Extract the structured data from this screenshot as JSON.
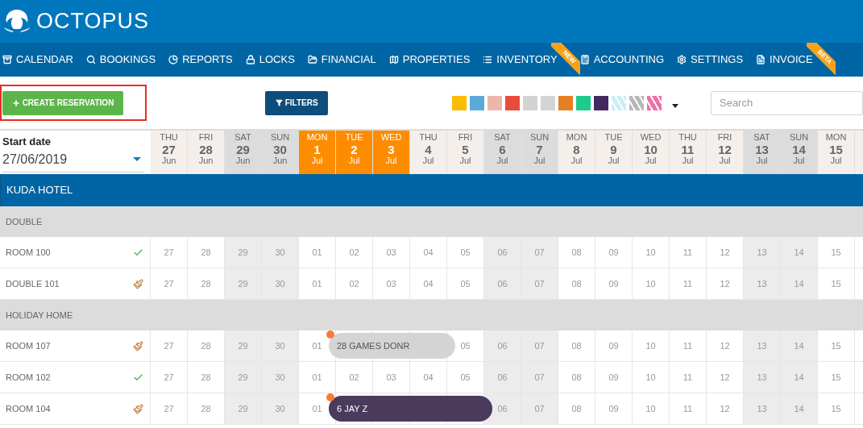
{
  "logo": {
    "text": "OCTOPUS"
  },
  "nav": [
    {
      "label": "CALENDAR"
    },
    {
      "label": "BOOKINGS"
    },
    {
      "label": "REPORTS"
    },
    {
      "label": "LOCKS"
    },
    {
      "label": "FINANCIAL"
    },
    {
      "label": "PROPERTIES"
    },
    {
      "label": "INVENTORY",
      "ribbon": "NEW"
    },
    {
      "label": "ACCOUNTING"
    },
    {
      "label": "SETTINGS"
    },
    {
      "label": "INVOICE",
      "ribbon": "BETA"
    }
  ],
  "toolbar": {
    "create_button": "CREATE RESERVATION",
    "filters_button": "FILTERS",
    "search": {
      "placeholder": "Search"
    },
    "swatches": [
      {
        "kind": "solid",
        "color": "#f9bd00"
      },
      {
        "kind": "solid",
        "color": "#5aaad9"
      },
      {
        "kind": "solid",
        "color": "#f0b5aa"
      },
      {
        "kind": "solid",
        "color": "#e74c3c"
      },
      {
        "kind": "solid",
        "color": "#d3d3d3"
      },
      {
        "kind": "solid",
        "color": "#d4d4d4"
      },
      {
        "kind": "solid",
        "color": "#e67e22"
      },
      {
        "kind": "solid",
        "color": "#1ecb8a"
      },
      {
        "kind": "solid",
        "color": "#432a5e"
      },
      {
        "kind": "striped",
        "color": "#c9eef7"
      },
      {
        "kind": "striped",
        "color": "#b8b8b8"
      },
      {
        "kind": "striped",
        "color": "#f06fa8"
      }
    ]
  },
  "start_date": {
    "label": "Start date",
    "value": "27/06/2019"
  },
  "days": [
    {
      "weekday": "THU",
      "day": "27",
      "month": "Jun",
      "weekend": false,
      "selected": false
    },
    {
      "weekday": "FRI",
      "day": "28",
      "month": "Jun",
      "weekend": false,
      "selected": false
    },
    {
      "weekday": "SAT",
      "day": "29",
      "month": "Jun",
      "weekend": true,
      "selected": false
    },
    {
      "weekday": "SUN",
      "day": "30",
      "month": "Jun",
      "weekend": true,
      "selected": false
    },
    {
      "weekday": "MON",
      "day": "1",
      "month": "Jul",
      "weekend": false,
      "selected": true
    },
    {
      "weekday": "TUE",
      "day": "2",
      "month": "Jul",
      "weekend": false,
      "selected": true
    },
    {
      "weekday": "WED",
      "day": "3",
      "month": "Jul",
      "weekend": false,
      "selected": true
    },
    {
      "weekday": "THU",
      "day": "4",
      "month": "Jul",
      "weekend": false,
      "selected": false
    },
    {
      "weekday": "FRI",
      "day": "5",
      "month": "Jul",
      "weekend": false,
      "selected": false
    },
    {
      "weekday": "SAT",
      "day": "6",
      "month": "Jul",
      "weekend": true,
      "selected": false
    },
    {
      "weekday": "SUN",
      "day": "7",
      "month": "Jul",
      "weekend": true,
      "selected": false
    },
    {
      "weekday": "MON",
      "day": "8",
      "month": "Jul",
      "weekend": false,
      "selected": false
    },
    {
      "weekday": "TUE",
      "day": "9",
      "month": "Jul",
      "weekend": false,
      "selected": false
    },
    {
      "weekday": "WED",
      "day": "10",
      "month": "Jul",
      "weekend": false,
      "selected": false
    },
    {
      "weekday": "THU",
      "day": "11",
      "month": "Jul",
      "weekend": false,
      "selected": false
    },
    {
      "weekday": "FRI",
      "day": "12",
      "month": "Jul",
      "weekend": false,
      "selected": false
    },
    {
      "weekday": "SAT",
      "day": "13",
      "month": "Jul",
      "weekend": true,
      "selected": false
    },
    {
      "weekday": "SUN",
      "day": "14",
      "month": "Jul",
      "weekend": true,
      "selected": false
    },
    {
      "weekday": "MON",
      "day": "15",
      "month": "Jul",
      "weekend": false,
      "selected": false
    }
  ],
  "hotel": {
    "name": "KUDA HOTEL"
  },
  "rows": [
    {
      "kind": "group",
      "name": "DOUBLE"
    },
    {
      "kind": "room",
      "name": "ROOM 100",
      "clean": true,
      "cells": [
        "27",
        "28",
        "29",
        "30",
        "01",
        "02",
        "03",
        "04",
        "05",
        "06",
        "07",
        "08",
        "09",
        "10",
        "11",
        "12",
        "13",
        "14",
        "15"
      ]
    },
    {
      "kind": "room",
      "name": "DOUBLE 101",
      "clean": false,
      "cells": [
        "27",
        "28",
        "29",
        "30",
        "01",
        "02",
        "03",
        "04",
        "05",
        "06",
        "07",
        "08",
        "09",
        "10",
        "11",
        "12",
        "13",
        "14",
        "15"
      ]
    },
    {
      "kind": "group",
      "name": "HOLIDAY HOME"
    },
    {
      "kind": "room",
      "name": "ROOM 107",
      "clean": false,
      "cells": [
        "27",
        "28",
        "29",
        "30",
        "01",
        null,
        null,
        null,
        "05",
        "06",
        "07",
        "08",
        "09",
        "10",
        "11",
        "12",
        "13",
        "14",
        "15"
      ],
      "booking": {
        "label": "28 GAMES DONR",
        "color": "#d4d4d4"
      }
    },
    {
      "kind": "room",
      "name": "ROOM 102",
      "clean": true,
      "cells": [
        "27",
        "28",
        "29",
        "30",
        "01",
        "02",
        "03",
        "04",
        "05",
        "06",
        "07",
        "08",
        "09",
        "10",
        "11",
        "12",
        "13",
        "14",
        "15"
      ]
    },
    {
      "kind": "room",
      "name": "ROOM 104",
      "clean": false,
      "cells": [
        "27",
        "28",
        "29",
        "30",
        "01",
        null,
        null,
        null,
        null,
        "06",
        "07",
        "08",
        "09",
        "10",
        "11",
        "12",
        "13",
        "14",
        "15"
      ],
      "booking": {
        "label": "6 JAY Z",
        "color": "#4a3a5c"
      }
    }
  ]
}
